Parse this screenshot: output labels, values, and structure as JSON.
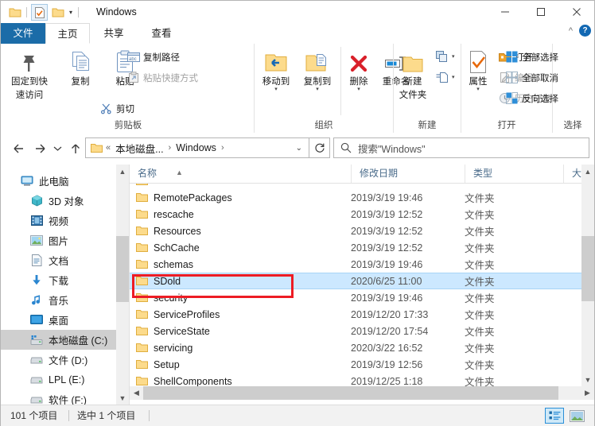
{
  "window": {
    "title": "Windows",
    "minimize_label": "最小化",
    "maximize_label": "最大化",
    "close_label": "关闭"
  },
  "quick_access": {
    "items": [
      "folder-icon",
      "properties-icon",
      "new-folder-icon"
    ],
    "dropdown_label": "自定义快速访问工具栏"
  },
  "ribbon": {
    "tabs": [
      {
        "label": "文件",
        "active": false,
        "file_menu": true
      },
      {
        "label": "主页",
        "active": true
      },
      {
        "label": "共享",
        "active": false
      },
      {
        "label": "查看",
        "active": false
      }
    ],
    "collapse_label": "^",
    "help_label": "?",
    "groups": [
      {
        "label": "剪贴板",
        "big_buttons": [
          {
            "label1": "固定到快",
            "label2": "速访问",
            "icon": "pin-icon"
          },
          {
            "label1": "复制",
            "label2": "",
            "icon": "copy-icon"
          },
          {
            "label1": "粘贴",
            "label2": "",
            "icon": "paste-icon",
            "has_caret": false
          }
        ],
        "small_buttons": [
          {
            "label": "剪切",
            "icon": "scissors-icon",
            "dim": false
          },
          {
            "label": "复制路径",
            "icon": "copy-path-icon",
            "dim": false
          },
          {
            "label": "粘贴快捷方式",
            "icon": "paste-shortcut-icon",
            "dim": true
          }
        ]
      },
      {
        "label": "组织",
        "big_buttons": [
          {
            "label1": "移动到",
            "label2": "",
            "icon": "move-to-icon",
            "has_caret": true
          },
          {
            "label1": "复制到",
            "label2": "",
            "icon": "copy-to-icon",
            "has_caret": true
          },
          {
            "label1": "删除",
            "label2": "",
            "icon": "delete-icon",
            "has_caret": true
          },
          {
            "label1": "重命名",
            "label2": "",
            "icon": "rename-icon",
            "has_caret": false
          }
        ]
      },
      {
        "label": "新建",
        "big_buttons": [
          {
            "label1": "新建",
            "label2": "文件夹",
            "icon": "new-folder-icon"
          }
        ],
        "small_buttons": [
          {
            "label": "",
            "icon": "new-item-icon",
            "dim": false
          },
          {
            "label": "",
            "icon": "easy-access-icon",
            "dim": false
          }
        ]
      },
      {
        "label": "打开",
        "big_buttons": [
          {
            "label1": "属性",
            "label2": "",
            "icon": "properties-icon",
            "has_caret": true
          }
        ],
        "small_buttons": [
          {
            "label": "打开",
            "icon": "open-icon",
            "dim": false,
            "has_caret": true
          },
          {
            "label": "编辑",
            "icon": "edit-icon",
            "dim": true
          },
          {
            "label": "历史记录",
            "icon": "history-icon",
            "dim": true
          }
        ]
      },
      {
        "label": "选择",
        "small_buttons": [
          {
            "label": "全部选择",
            "icon": "select-all-icon",
            "dim": false
          },
          {
            "label": "全部取消",
            "icon": "select-none-icon",
            "dim": false
          },
          {
            "label": "反向选择",
            "icon": "invert-selection-icon",
            "dim": false
          }
        ]
      }
    ]
  },
  "navbar": {
    "back_label": "后退",
    "forward_label": "前进",
    "recent_label": "最近浏览的位置",
    "up_label": "上移到",
    "breadcrumbs": [
      "本地磁盘...",
      "Windows"
    ],
    "overflow": "«",
    "separator": "›",
    "dropdown": "⌄",
    "refresh_label": "刷新"
  },
  "search": {
    "placeholder": "搜索\"Windows\"",
    "icon": "search-icon"
  },
  "sidebar": {
    "items": [
      {
        "label": "此电脑",
        "icon": "computer-icon",
        "indent": 0,
        "selected": false
      },
      {
        "label": "3D 对象",
        "icon": "3d-objects-icon",
        "indent": 1,
        "selected": false
      },
      {
        "label": "视频",
        "icon": "videos-icon",
        "indent": 1,
        "selected": false
      },
      {
        "label": "图片",
        "icon": "pictures-icon",
        "indent": 1,
        "selected": false
      },
      {
        "label": "文档",
        "icon": "documents-icon",
        "indent": 1,
        "selected": false
      },
      {
        "label": "下载",
        "icon": "downloads-icon",
        "indent": 1,
        "selected": false
      },
      {
        "label": "音乐",
        "icon": "music-icon",
        "indent": 1,
        "selected": false
      },
      {
        "label": "桌面",
        "icon": "desktop-icon",
        "indent": 1,
        "selected": false
      },
      {
        "label": "本地磁盘 (C:)",
        "icon": "local-disk-icon",
        "indent": 1,
        "selected": true
      },
      {
        "label": "文件 (D:)",
        "icon": "drive-icon",
        "indent": 1,
        "selected": false
      },
      {
        "label": "LPL (E:)",
        "icon": "drive-icon",
        "indent": 1,
        "selected": false
      },
      {
        "label": "软件 (F:)",
        "icon": "drive-icon",
        "indent": 1,
        "selected": false
      }
    ]
  },
  "filelist": {
    "columns": [
      {
        "label": "名称",
        "sorted": true,
        "sort_dir": "asc"
      },
      {
        "label": "修改日期",
        "sorted": false
      },
      {
        "label": "类型",
        "sorted": false
      },
      {
        "label": "大小",
        "sorted": false
      }
    ],
    "rows": [
      {
        "name": "RemotePackages",
        "date": "2019/3/19 19:46",
        "type": "文件夹",
        "selected": false
      },
      {
        "name": "rescache",
        "date": "2019/3/19 12:52",
        "type": "文件夹",
        "selected": false
      },
      {
        "name": "Resources",
        "date": "2019/3/19 12:52",
        "type": "文件夹",
        "selected": false
      },
      {
        "name": "SchCache",
        "date": "2019/3/19 12:52",
        "type": "文件夹",
        "selected": false
      },
      {
        "name": "schemas",
        "date": "2019/3/19 19:46",
        "type": "文件夹",
        "selected": false
      },
      {
        "name": "SDold",
        "date": "2020/6/25 11:00",
        "type": "文件夹",
        "selected": true
      },
      {
        "name": "security",
        "date": "2019/3/19 19:46",
        "type": "文件夹",
        "selected": false
      },
      {
        "name": "ServiceProfiles",
        "date": "2019/12/20 17:33",
        "type": "文件夹",
        "selected": false
      },
      {
        "name": "ServiceState",
        "date": "2019/12/20 17:54",
        "type": "文件夹",
        "selected": false
      },
      {
        "name": "servicing",
        "date": "2020/3/22 16:52",
        "type": "文件夹",
        "selected": false
      },
      {
        "name": "Setup",
        "date": "2019/3/19 12:56",
        "type": "文件夹",
        "selected": false
      },
      {
        "name": "ShellComponents",
        "date": "2019/12/25 1:18",
        "type": "文件夹",
        "selected": false
      }
    ]
  },
  "status": {
    "item_count": "101 个项目",
    "selection": "选中 1 个项目",
    "view_details_label": "详细信息",
    "view_large_icons_label": "大图标"
  },
  "annotation": {
    "color": "#ed1c24",
    "target": "SDold"
  }
}
